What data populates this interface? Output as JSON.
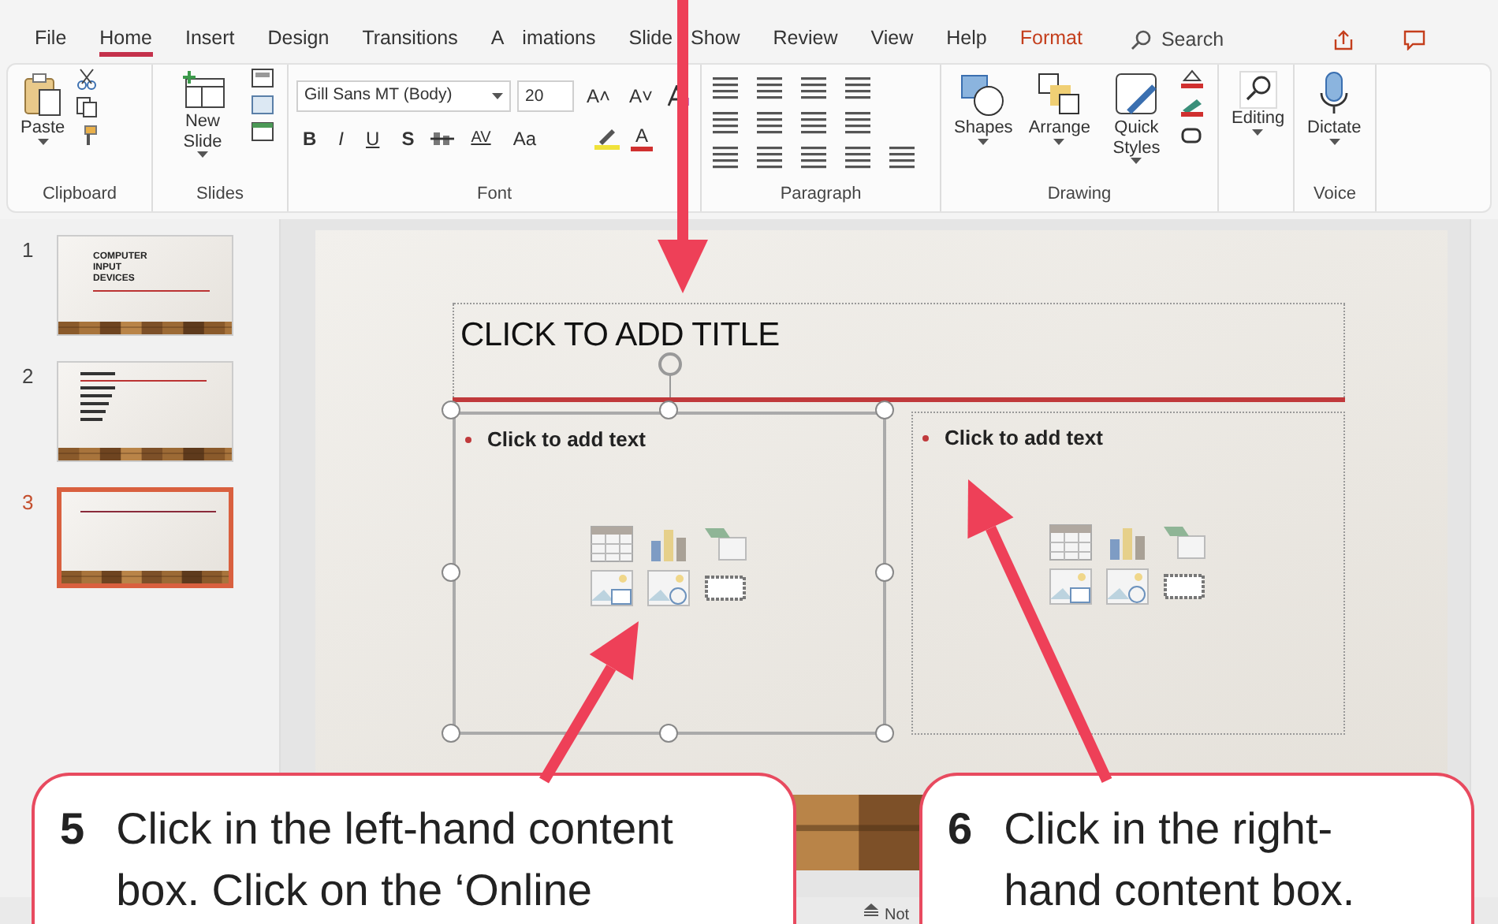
{
  "ribbon_tabs": [
    {
      "label": "File",
      "selected": false,
      "kind": "normal"
    },
    {
      "label": "Home",
      "selected": true,
      "kind": "normal"
    },
    {
      "label": "Insert",
      "selected": false,
      "kind": "normal"
    },
    {
      "label": "Design",
      "selected": false,
      "kind": "normal"
    },
    {
      "label": "Transitions",
      "selected": false,
      "kind": "normal"
    },
    {
      "label": "A imations",
      "selected": false,
      "kind": "normal"
    },
    {
      "label": "Slide Show",
      "selected": false,
      "kind": "normal"
    },
    {
      "label": "Review",
      "selected": false,
      "kind": "normal"
    },
    {
      "label": "View",
      "selected": false,
      "kind": "normal"
    },
    {
      "label": "Help",
      "selected": false,
      "kind": "normal"
    },
    {
      "label": "Format",
      "selected": false,
      "kind": "contextual"
    }
  ],
  "search": {
    "label": "Search"
  },
  "ribbon": {
    "clipboard": {
      "label": "Clipboard",
      "paste": "Paste"
    },
    "slides": {
      "label": "Slides",
      "new_slide": "New Slide"
    },
    "font": {
      "label": "Font",
      "font_name": "Gill Sans MT (Body)",
      "font_size": "20",
      "grow": "A˄",
      "shrink": "A˅",
      "styles": [
        "B",
        "I",
        "U",
        "S"
      ],
      "spacing": "AV",
      "change_case": "Aa",
      "font_color": "A"
    },
    "paragraph": {
      "label": "Paragraph"
    },
    "drawing": {
      "label": "Drawing",
      "buttons": [
        "Shapes",
        "Arrange",
        "Quick Styles"
      ]
    },
    "editing": {
      "label": "Editing"
    },
    "voice": {
      "label": "Voice",
      "dictate": "Dictate"
    }
  },
  "thumbnails": [
    {
      "number": "1",
      "kind": "title",
      "title": "COMPUTER INPUT DEVICES",
      "selected": false
    },
    {
      "number": "2",
      "kind": "list",
      "selected": false
    },
    {
      "number": "3",
      "kind": "blank",
      "selected": true
    }
  ],
  "slide": {
    "title_placeholder": "CLICK TO ADD TITLE",
    "content_boxes": [
      {
        "text": "Click to add text",
        "selected": true
      },
      {
        "text": "Click to add text",
        "selected": false
      }
    ]
  },
  "status_bar": {
    "notes": "Not"
  },
  "callouts": [
    {
      "number": "5",
      "text": "Click in the left-hand content box. Click on the ‘Online"
    },
    {
      "number": "6",
      "text": "Click in the right-hand content box."
    }
  ]
}
